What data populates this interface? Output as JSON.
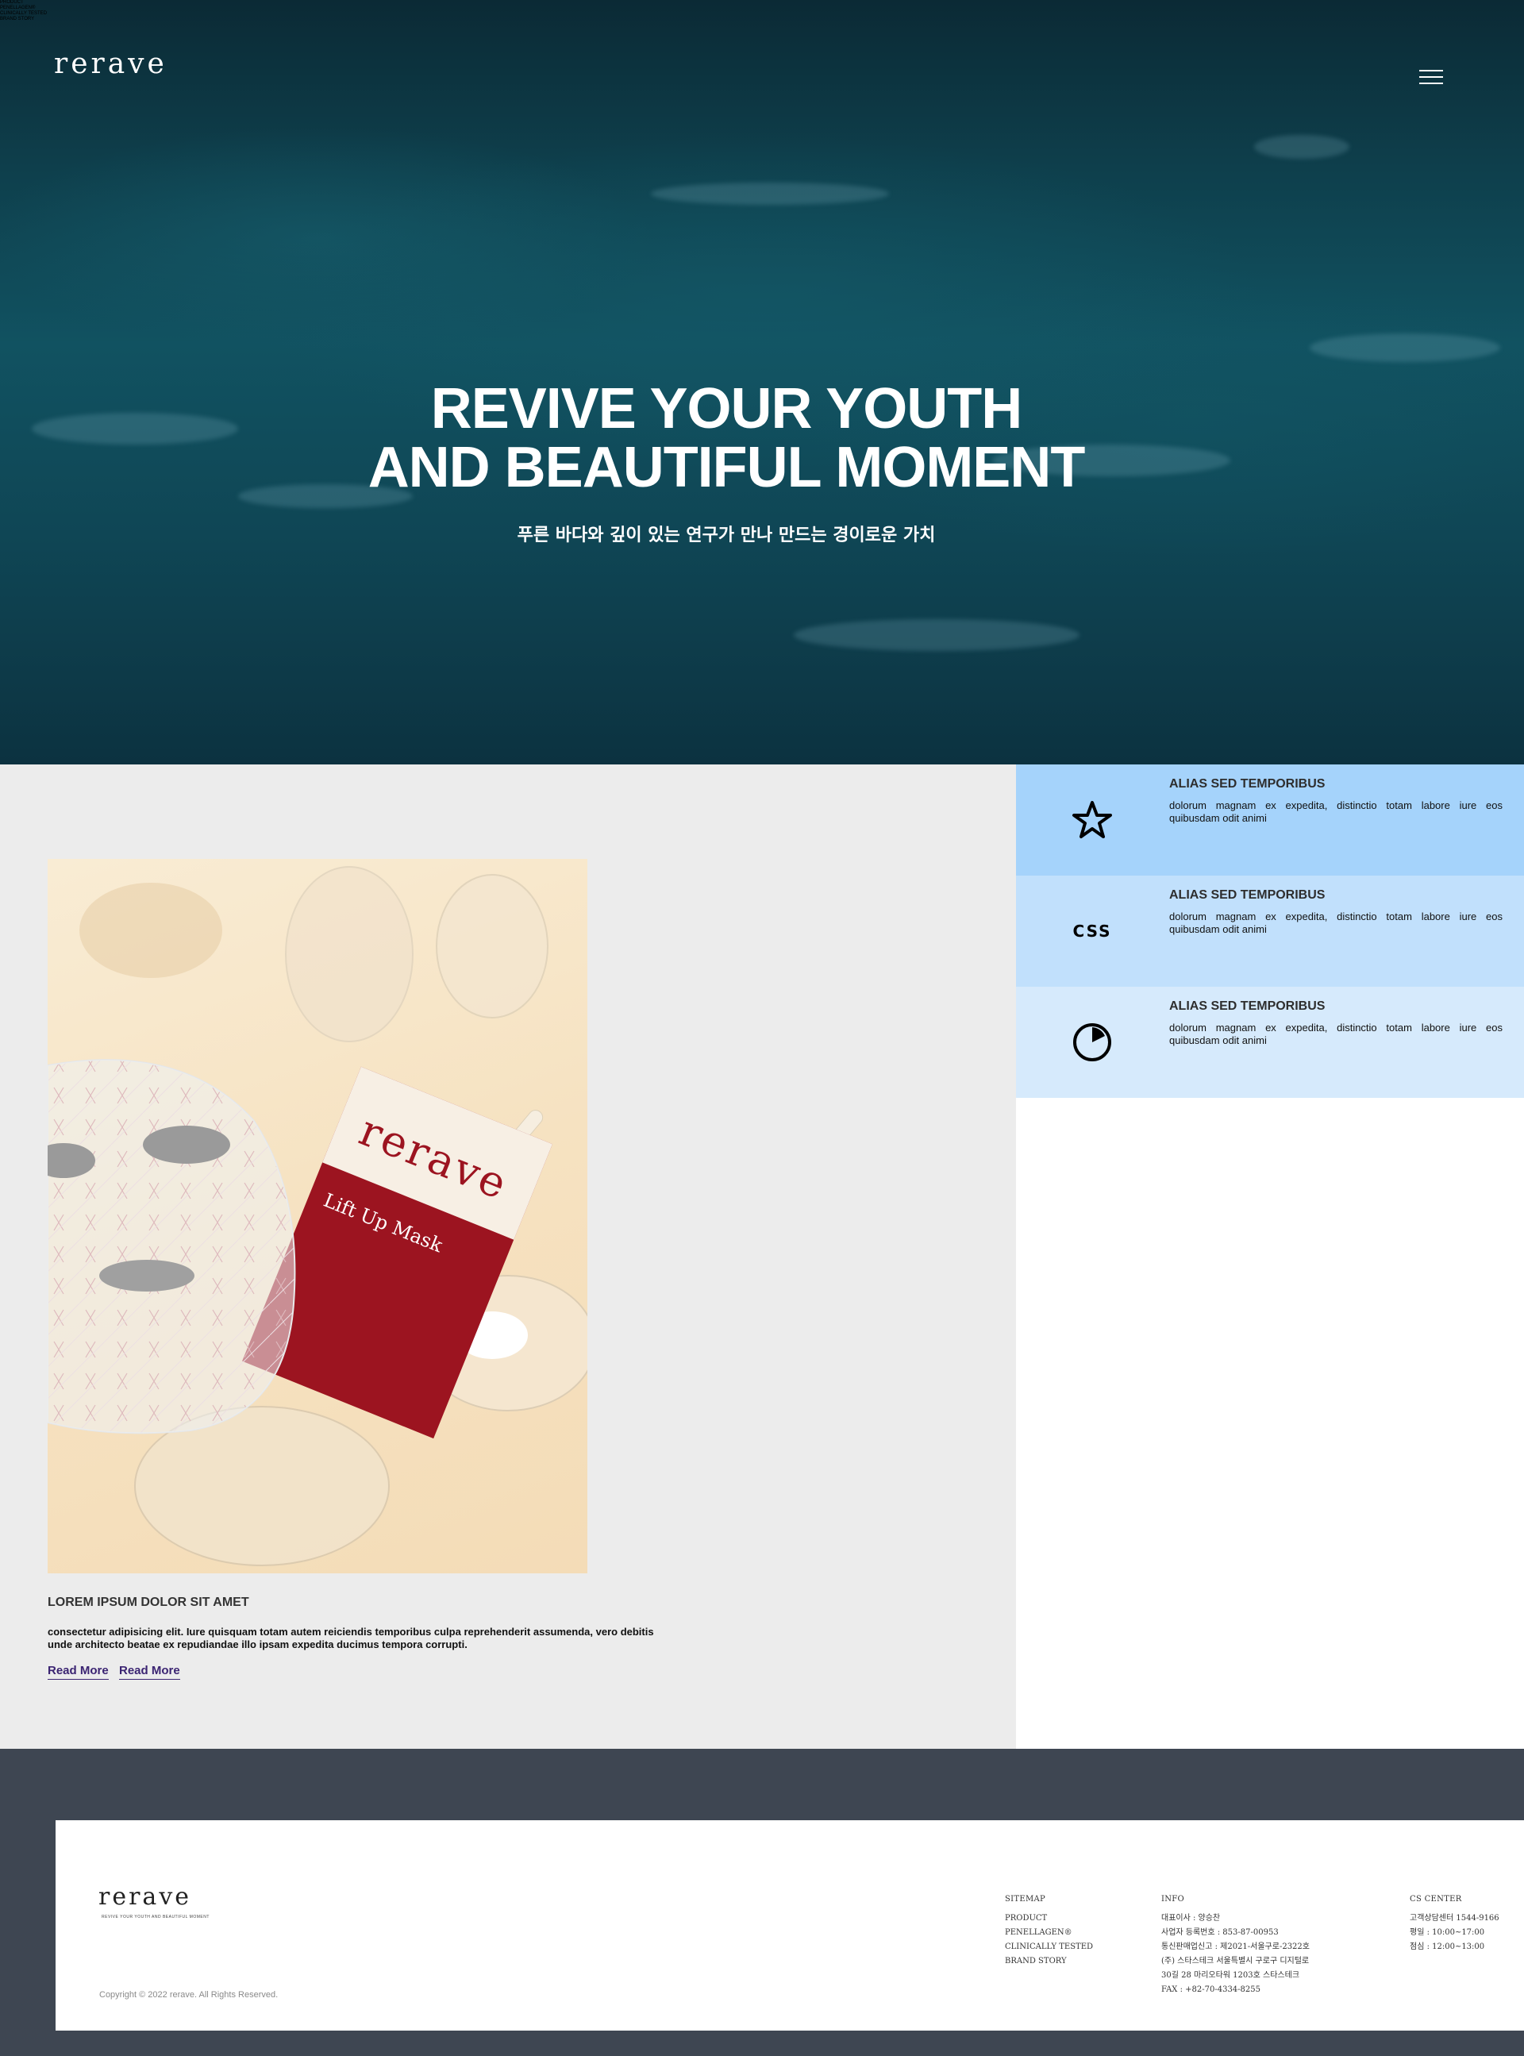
{
  "stray_text": [
    "PRODUCT",
    "PENELLAGEN®",
    "CLINICALLY TESTED",
    "BRAND STORY"
  ],
  "header": {
    "logo": "rerave"
  },
  "hero": {
    "title_line1": "REVIVE YOUR YOUTH",
    "title_line2": "AND BEAUTIFUL MOMENT",
    "subtitle": "푸른 바다와 깊이 있는 연구가 만나 만드는 경이로운 가치"
  },
  "card": {
    "title": "LOREM IPSUM DOLOR SIT AMET",
    "text": "consectetur adipisicing elit. Iure quisquam totam autem reiciendis temporibus culpa reprehenderit assumenda, vero debitis unde architecto beatae ex repudiandae illo ipsam expedita ducimus tempora corrupti.",
    "read_more_1": "Read More",
    "read_more_2": "Read More"
  },
  "features": [
    {
      "icon": "star-icon",
      "title": "ALIAS SED TEMPORIBUS",
      "text": "dolorum magnam ex expedita, distinctio totam labore iure eos quibusdam odit animi",
      "bg": "#a5d3fb"
    },
    {
      "icon": "css-icon",
      "icon_text": "CSS",
      "title": "ALIAS SED TEMPORIBUS",
      "text": "dolorum magnam ex expedita, distinctio totam labore iure eos quibusdam odit animi",
      "bg": "#c1e0fc"
    },
    {
      "icon": "pie-chart-icon",
      "title": "ALIAS SED TEMPORIBUS",
      "text": "dolorum magnam ex expedita, distinctio totam labore iure eos quibusdam odit animi",
      "bg": "#d6eafc"
    }
  ],
  "footer": {
    "logo": "rerave",
    "logo_sub": "REVIVE YOUR YOUTH AND BEAUTIFUL MOMENT",
    "copyright": "Copyright © 2022 rerave. All Rights Reserved.",
    "sitemap": {
      "heading": "SITEMAP",
      "items": [
        "PRODUCT",
        "PENELLAGEN®",
        "CLINICALLY TESTED",
        "BRAND STORY"
      ]
    },
    "info": {
      "heading": "INFO",
      "items": [
        "대표이사 : 양승찬",
        "사업자 등록번호 : 853-87-00953",
        "통신판매업신고 : 제2021-서울구로-2322호",
        "(주) 스타스테크 서울특별시 구로구 디지털로",
        "30길 28 마리오타워 1203호 스타스테크",
        "FAX : +82-70-4334-8255"
      ]
    },
    "cs": {
      "heading": "CS CENTER",
      "items": [
        "고객상담센터 1544-9166",
        "평일 : 10:00~17:00",
        "점심 : 12:00~13:00"
      ]
    }
  }
}
